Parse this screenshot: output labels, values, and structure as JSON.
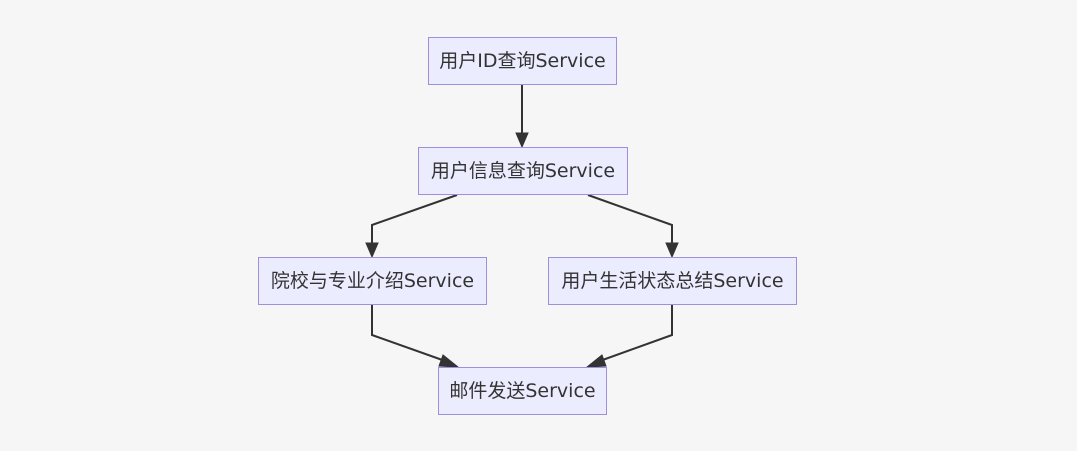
{
  "diagram": {
    "type": "flowchart",
    "direction": "top-to-bottom",
    "colors": {
      "background": "#f6f6f7",
      "node_fill": "#ececff",
      "node_border": "#9f8fdb",
      "edge": "#333333",
      "text": "#333333"
    },
    "nodes": [
      {
        "id": "n1",
        "label": "用户ID查询Service"
      },
      {
        "id": "n2",
        "label": "用户信息查询Service"
      },
      {
        "id": "n3",
        "label": "院校与专业介绍Service"
      },
      {
        "id": "n4",
        "label": "用户生活状态总结Service"
      },
      {
        "id": "n5",
        "label": "邮件发送Service"
      }
    ],
    "edges": [
      {
        "from": "n1",
        "to": "n2"
      },
      {
        "from": "n2",
        "to": "n3"
      },
      {
        "from": "n2",
        "to": "n4"
      },
      {
        "from": "n3",
        "to": "n5"
      },
      {
        "from": "n4",
        "to": "n5"
      }
    ]
  }
}
